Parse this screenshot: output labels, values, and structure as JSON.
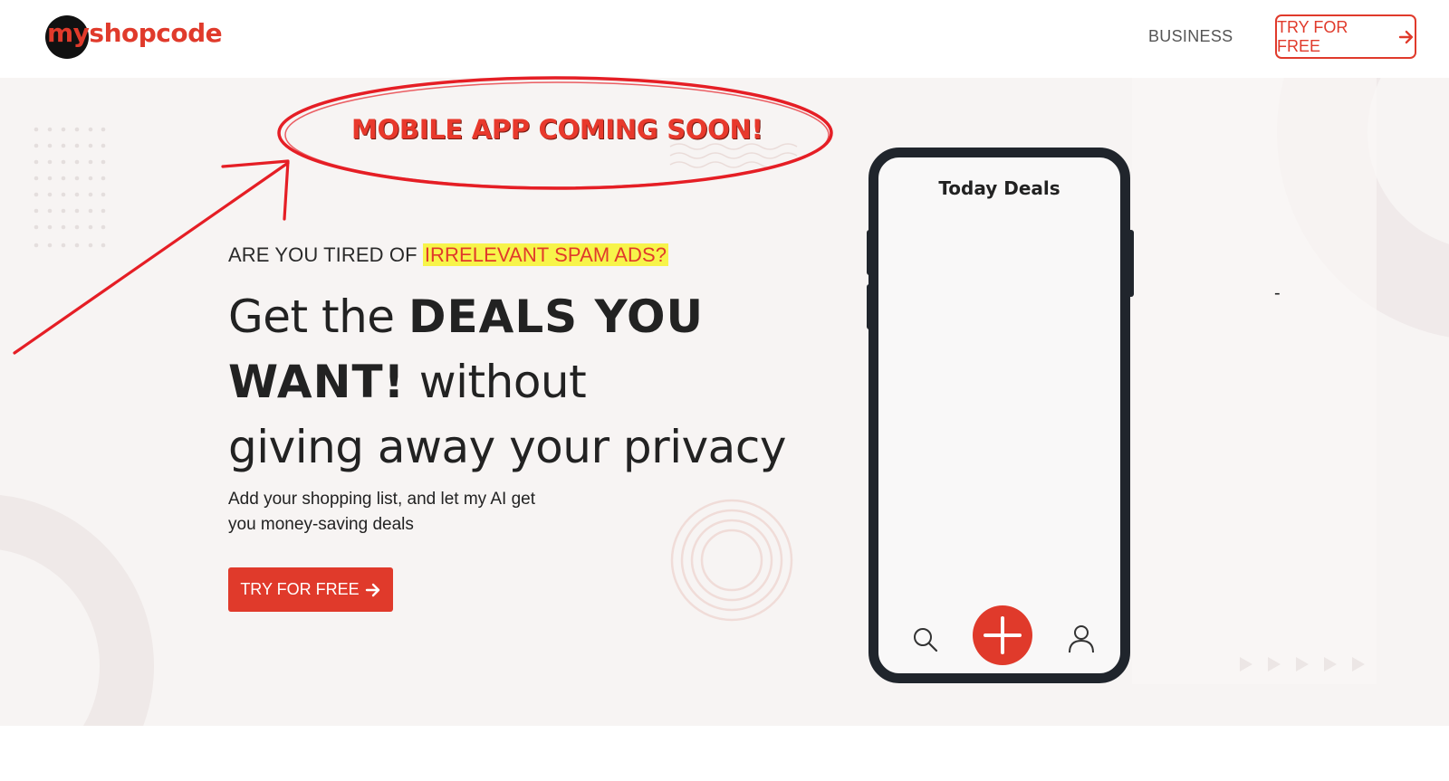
{
  "brand": {
    "logo_text": "myshopcode",
    "accent_color": "#e03a2b",
    "dark_color": "#20252c"
  },
  "nav": {
    "business_label": "BUSINESS",
    "try_label": "TRY FOR FREE",
    "try_icon": "arrow-right-icon"
  },
  "annotation": {
    "text": "MOBILE APP COMING SOON!",
    "color": "#e8392c"
  },
  "hero": {
    "tired_prefix": "ARE YOU TIRED OF",
    "tired_highlight": "IRRELEVANT SPAM ADS?",
    "headline_part1": "Get the ",
    "headline_bold1": "DEALS YOU",
    "headline_bold2": "WANT!",
    "headline_part2": " without",
    "headline_line3": "giving away your privacy",
    "sub_line1": "Add your shopping list, and let my AI get",
    "sub_line2": "you money-saving deals",
    "cta_label": "TRY FOR FREE",
    "cta_icon": "arrow-right-icon"
  },
  "phone": {
    "title": "Today Deals",
    "nav_icons": [
      "search-icon",
      "plus-icon",
      "user-icon"
    ]
  },
  "misc": {
    "dash_text": "-"
  }
}
